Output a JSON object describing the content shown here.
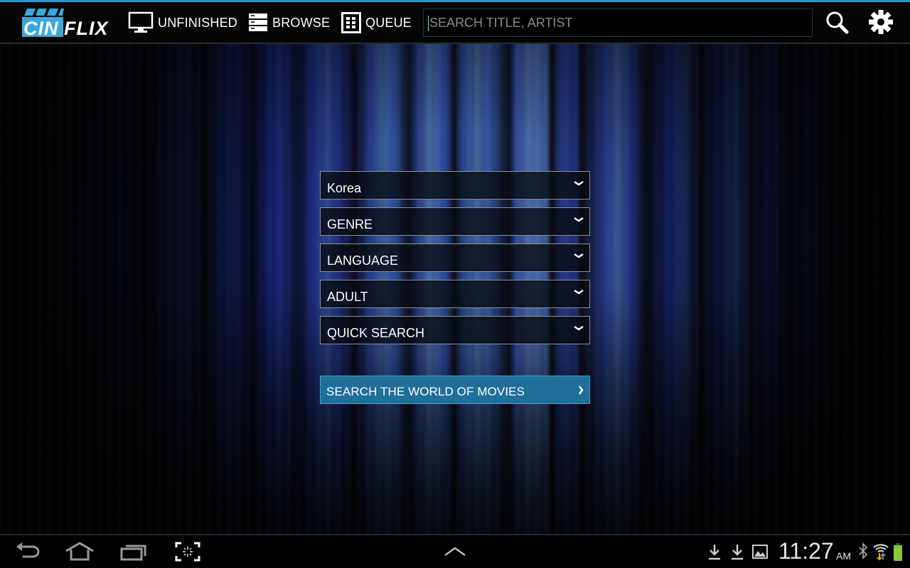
{
  "app": {
    "name_part1": "CIN",
    "name_part2": "FLIX",
    "accent_color": "#1a9ad6"
  },
  "nav": {
    "items": [
      {
        "id": "unfinished",
        "label": "UNFINISHED",
        "icon": "monitor-icon"
      },
      {
        "id": "browse",
        "label": "BROWSE",
        "icon": "server-list-icon"
      },
      {
        "id": "queue",
        "label": "QUEUE",
        "icon": "grid-list-icon"
      }
    ]
  },
  "search": {
    "placeholder": "SEARCH TITLE, ARTIST",
    "value": "",
    "search_icon": "magnifier-icon",
    "settings_icon": "gear-icon"
  },
  "filters": {
    "dropdowns": [
      {
        "id": "country",
        "selected": "Korea"
      },
      {
        "id": "genre",
        "selected": "GENRE"
      },
      {
        "id": "language",
        "selected": "LANGUAGE"
      },
      {
        "id": "adult",
        "selected": "ADULT"
      },
      {
        "id": "quick-search",
        "selected": "QUICK SEARCH"
      }
    ],
    "submit_label": "SEARCH THE WORLD OF MOVIES",
    "submit_color": "#1f6f98"
  },
  "system_bar": {
    "nav_buttons": [
      "back-icon",
      "home-icon",
      "recent-apps-icon",
      "screenshot-icon"
    ],
    "center": "chevron-up-icon",
    "notifications": [
      "download-icon",
      "download-icon",
      "image-icon"
    ],
    "time": "11:27",
    "ampm": "AM",
    "status": [
      "bluetooth-icon",
      "wifi-icon",
      "battery-icon"
    ],
    "battery_color": "#8cc63f"
  }
}
